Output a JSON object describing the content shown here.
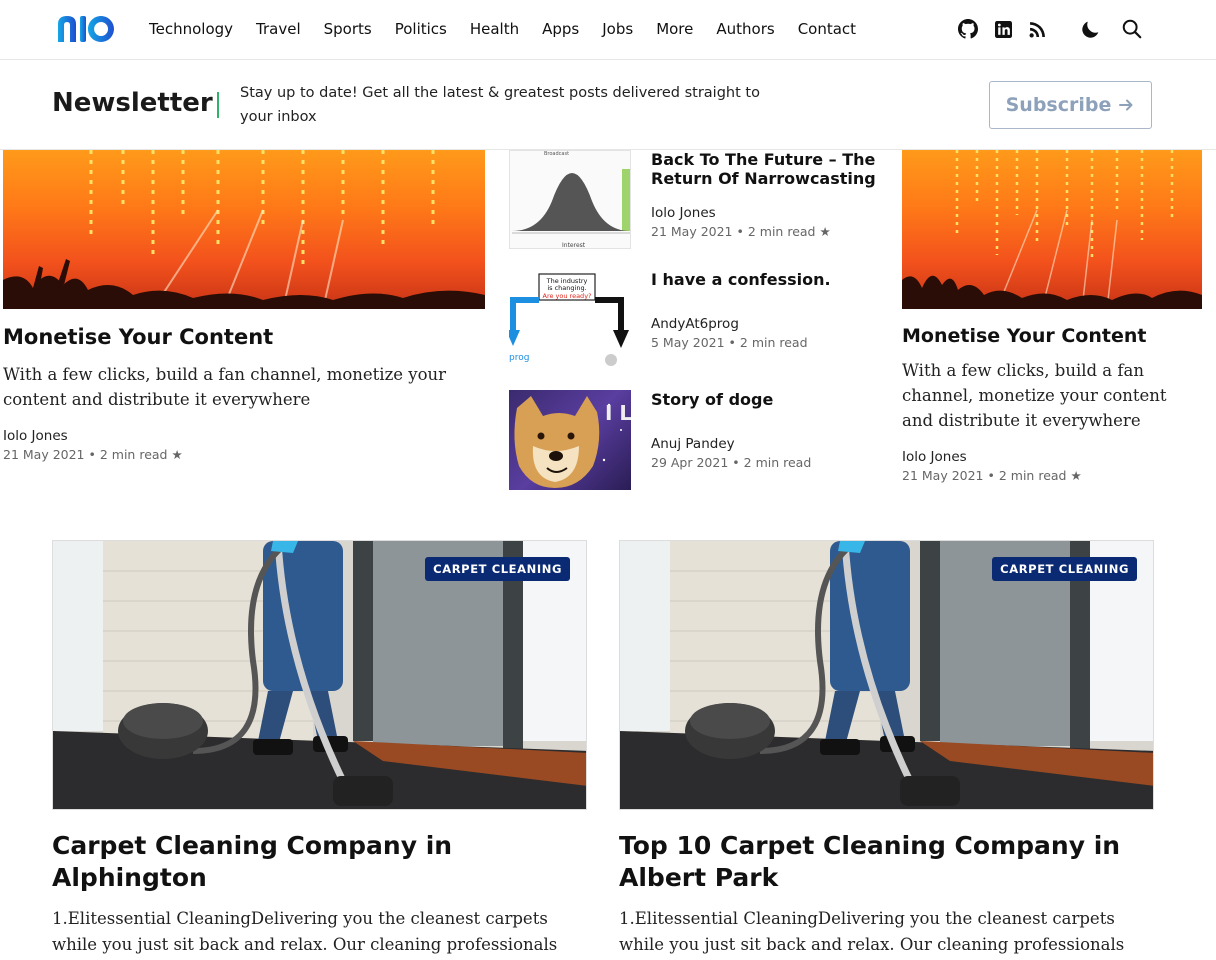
{
  "brand": {
    "logo_text": "nio",
    "accent": "#1e6fd9"
  },
  "nav": {
    "items": [
      "Technology",
      "Travel",
      "Sports",
      "Politics",
      "Health",
      "Apps",
      "Jobs",
      "More",
      "Authors",
      "Contact"
    ]
  },
  "header_icons": [
    "github-icon",
    "linkedin-icon",
    "rss-icon",
    "moon-icon",
    "search-icon"
  ],
  "newsletter": {
    "title": "Newsletter",
    "text": "Stay up to date! Get all the latest & greatest posts delivered straight to your inbox",
    "button_label": "Subscribe",
    "button_color": "#8ea1ba"
  },
  "featured_left": {
    "title": "Monetise Your Content",
    "excerpt": "With a few clicks, build a fan channel, monetize your content and distribute it everywhere",
    "author": "Iolo Jones",
    "date": "21 May 2021",
    "read_time": "2 min read"
  },
  "mid_list": [
    {
      "title": "Back To The Future – The Return Of Narrowcasting",
      "author": "Iolo Jones",
      "date": "21 May 2021",
      "read_time": "2 min read",
      "star": true,
      "thumb_label_top": "Broadcast",
      "thumb_label_bottom": "Interest"
    },
    {
      "title": "I have a confession.",
      "author": "AndyAt6prog",
      "date": "5 May 2021",
      "read_time": "2 min read",
      "star": false,
      "thumb_text_1": "The industry",
      "thumb_text_2": "is changing.",
      "thumb_text_3": "Are you ready?",
      "thumb_text_4": "prog"
    },
    {
      "title": "Story of doge",
      "author": "Anuj Pandey",
      "date": "29 Apr 2021",
      "read_time": "2 min read",
      "star": false,
      "thumb_text": "I LIK IT"
    }
  ],
  "featured_right": {
    "title": "Monetise Your Content",
    "excerpt": "With a few clicks, build a fan channel, monetize your content and distribute it everywhere",
    "author": "Iolo Jones",
    "date": "21 May 2021",
    "read_time": "2 min read"
  },
  "bottom_cards": [
    {
      "badge": "CARPET CLEANING",
      "title": "Carpet Cleaning Company in Alphington",
      "excerpt": "1.Elitessential CleaningDelivering you the cleanest carpets while you just sit back and relax. Our cleaning professionals"
    },
    {
      "badge": "CARPET CLEANING",
      "title": "Top 10 Carpet Cleaning Company in Albert Park",
      "excerpt": "1.Elitessential CleaningDelivering you the cleanest carpets while you just sit back and relax. Our cleaning professionals"
    }
  ],
  "meta_separator": "•",
  "star_glyph": "★",
  "badge_color": "#0a2b73"
}
